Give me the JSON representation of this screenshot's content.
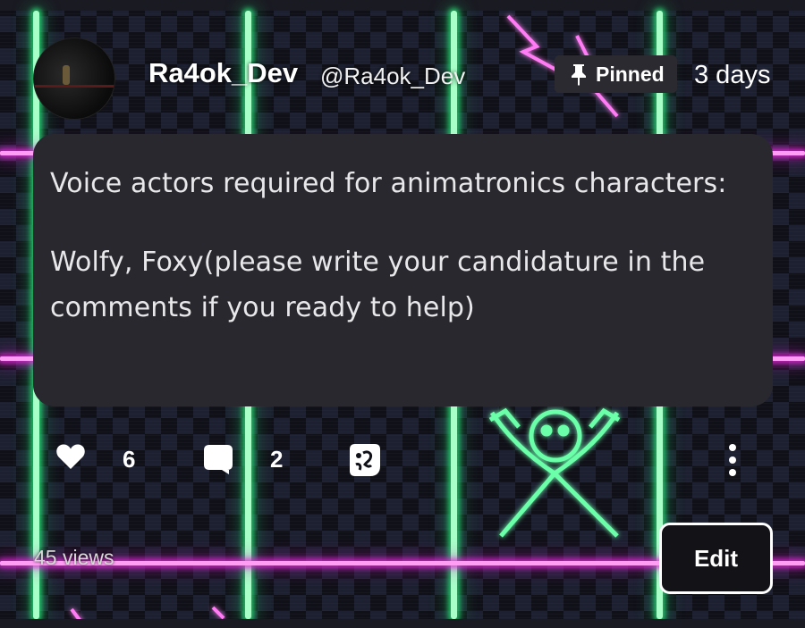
{
  "post": {
    "author": {
      "display_name": "Ra4ok_Dev",
      "handle": "@Ra4ok_Dev"
    },
    "pinned_label": "Pinned",
    "timestamp": "3 days",
    "body": {
      "paragraph_1": "Voice actors required for animatronics characters:",
      "paragraph_2": "Wolfy, Foxy(please write your candidature in the comments if you ready to help)"
    },
    "actions": {
      "like_count": "6",
      "comment_count": "2"
    },
    "views": "45 views",
    "edit_label": "Edit"
  },
  "icons": [
    "heart-icon",
    "comment-icon",
    "share-icon",
    "more-options-icon",
    "pin-icon"
  ],
  "colors": {
    "card_background": "#29282e",
    "pinned_badge": "#2b2a30",
    "neon_green": "#3cf08a",
    "neon_magenta": "#ff4ef0",
    "text": "#ffffff"
  }
}
